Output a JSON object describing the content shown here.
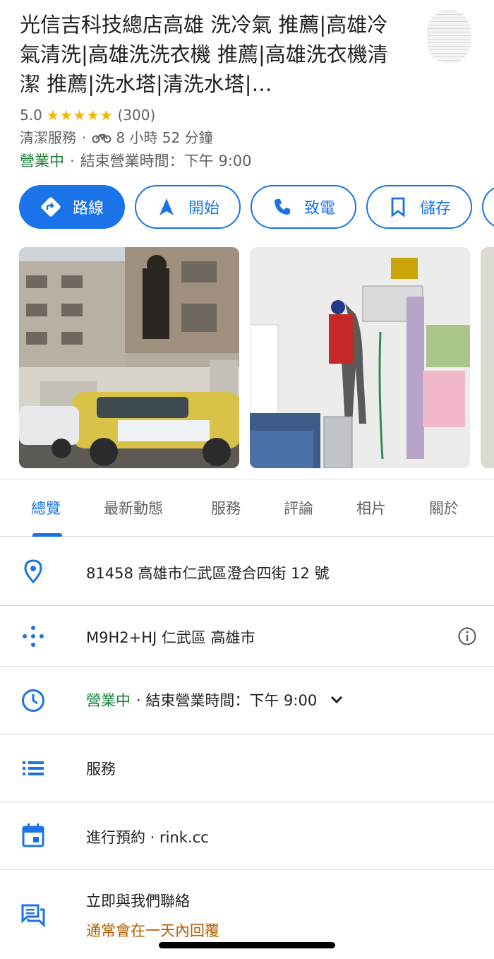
{
  "place": {
    "title": "光信吉科技總店高雄 洗冷氣 推薦|高雄冷氣清洗|高雄洗洗衣機 推薦|高雄洗衣機清潔 推薦|洗水塔|清洗水塔|…",
    "rating": "5.0",
    "stars": "★★★★★",
    "review_count": "(300)",
    "category": "清潔服務",
    "travel_time": "8 小時 52 分鐘",
    "open_status": "營業中",
    "closing": "結束營業時間：下午 9:00",
    "separator": "·"
  },
  "actions": {
    "directions": "路線",
    "start": "開始",
    "call": "致電",
    "save": "儲存"
  },
  "tabs": [
    "總覽",
    "最新動態",
    "服務",
    "評論",
    "相片",
    "關於"
  ],
  "details": {
    "address": "81458 高雄市仁武區澄合四街 12 號",
    "plus_code": "M9H2+HJ 仁武區 高雄市",
    "hours_status": "營業中",
    "hours_text": "· 結束營業時間：下午 9:00",
    "services": "服務",
    "booking": "進行預約 · rink.cc",
    "contact": "立即與我們聯絡",
    "contact_sub": "通常會在一天內回覆"
  },
  "colors": {
    "accent": "#1a73e8",
    "open_green": "#188038",
    "star_yellow": "#f4b400",
    "reply_orange": "#b06000"
  },
  "icons": [
    "directions-icon",
    "navigation-arrow-icon",
    "phone-icon",
    "bookmark-icon",
    "location-pin-icon",
    "plus-code-icon",
    "clock-icon",
    "chevron-down-icon",
    "list-icon",
    "calendar-icon",
    "chat-icon",
    "info-icon",
    "motorcycle-icon"
  ]
}
